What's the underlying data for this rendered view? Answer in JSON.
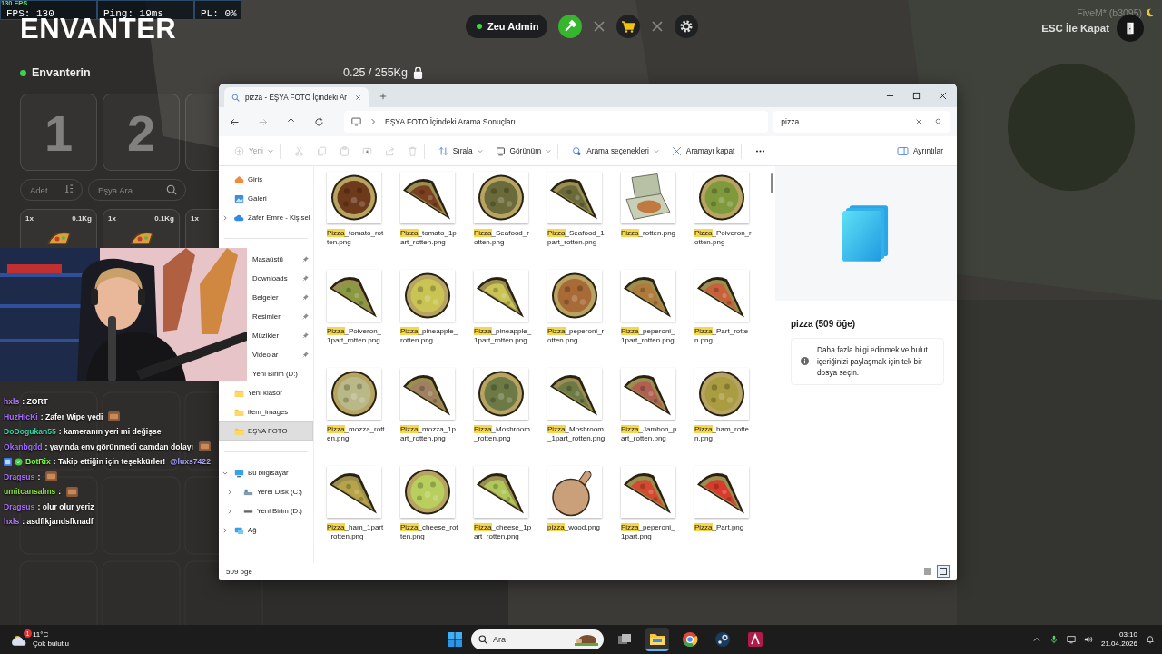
{
  "perf": {
    "fps_small": "130 FPS",
    "fps": "FPS: 130",
    "ping": "Ping: 19ms",
    "pl": "PL: 0%"
  },
  "hud": {
    "title": "ENVANTER",
    "inventory_label": "Envanterin",
    "weight": "0.25 / 255Kg",
    "amount_placeholder": "Adet",
    "search_placeholder": "Eşya Ara",
    "slots": [
      {
        "kind": "number",
        "number": "1"
      },
      {
        "kind": "number",
        "number": "2"
      },
      {
        "kind": "empty"
      }
    ],
    "item_slots": [
      {
        "count": "1x",
        "weight": "0.1Kg"
      },
      {
        "count": "1x",
        "weight": "0.1Kg"
      },
      {
        "count": "1x"
      }
    ]
  },
  "admin": {
    "name": "Zeu Admin",
    "tools": [
      {
        "kind": "tool",
        "active": true
      },
      {
        "kind": "close",
        "active": false
      },
      {
        "kind": "cart",
        "active": false
      },
      {
        "kind": "close",
        "active": false
      },
      {
        "kind": "settings",
        "active": false
      }
    ]
  },
  "top_right": {
    "build": "FiveM* (b3095)",
    "close_hint": "ESC İle Kapat"
  },
  "chat": [
    {
      "user": "hxls",
      "color": "#b07cff",
      "text": ": ZORT"
    },
    {
      "user": "HuzHicKi",
      "color": "#a56cff",
      "text": ": Zafer Wipe yedi",
      "emote": true
    },
    {
      "user": "DoDogukan55",
      "color": "#2fd6a6",
      "text": ": kameranın yeri mi değişse"
    },
    {
      "user": "Okanbgdd",
      "color": "#9d6cff",
      "text": ": yayında env görünmedi camdan dolayı",
      "emote": true
    },
    {
      "user": "BotRix",
      "color": "#7dff3a",
      "text": ": Takip ettiğin için teşekkürler!",
      "mention": "@luxs7422",
      "badges": true
    },
    {
      "user": "Dragsus",
      "color": "#a56cff",
      "text": ":",
      "emote": true
    },
    {
      "user": "umitcansalms",
      "color": "#8fe03c",
      "text": ":",
      "emote": true
    },
    {
      "user": "Dragsus",
      "color": "#a56cff",
      "text": ": olur olur yeriz"
    },
    {
      "user": "hxls",
      "color": "#b07cff",
      "text": ": asdflkjandsfknadf"
    }
  ],
  "explorer": {
    "tab_title": "pizza - EŞYA FOTO İçindeki Ar",
    "address": "EŞYA FOTO İçindeki Arama Sonuçları",
    "search": "pizza",
    "history": [
      {
        "kind": "back",
        "disabled": false
      },
      {
        "kind": "forward",
        "disabled": true
      },
      {
        "kind": "up",
        "disabled": false
      },
      {
        "kind": "refresh",
        "disabled": false
      }
    ],
    "toolbar": [
      {
        "kind": "new",
        "label": "Yeni",
        "disabled": true,
        "dropdown": true
      },
      {
        "kind": "cut",
        "disabled": true
      },
      {
        "kind": "copy",
        "disabled": true
      },
      {
        "kind": "paste",
        "disabled": true
      },
      {
        "kind": "rename",
        "disabled": true
      },
      {
        "kind": "share",
        "disabled": true
      },
      {
        "kind": "delete",
        "disabled": true
      },
      {
        "kind": "sort",
        "label": "Sırala",
        "disabled": false,
        "dropdown": true
      },
      {
        "kind": "view",
        "label": "Görünüm",
        "disabled": false,
        "dropdown": true
      },
      {
        "kind": "search-options",
        "label": "Arama seçenekleri",
        "disabled": false,
        "dropdown": true
      },
      {
        "kind": "close-search",
        "label": "Aramayı kapat",
        "disabled": false
      },
      {
        "kind": "more",
        "disabled": false
      }
    ],
    "details_toggle": "Ayrıntılar",
    "nav": [
      {
        "items": [
          {
            "label": "Giriş",
            "kind": "home",
            "selected": false
          },
          {
            "label": "Galeri",
            "kind": "gallery",
            "selected": false
          },
          {
            "label": "Zafer Emre - Kişisel",
            "kind": "cloud",
            "expanded": false,
            "selected": false
          }
        ]
      },
      {
        "items": [
          {
            "label": "Masaüstü",
            "pinned": true,
            "selected": false
          },
          {
            "label": "Downloads",
            "pinned": true,
            "selected": false
          },
          {
            "label": "Belgeler",
            "pinned": true,
            "selected": false
          },
          {
            "label": "Resimler",
            "pinned": true,
            "selected": false
          },
          {
            "label": "Müzikler",
            "pinned": true,
            "selected": false
          },
          {
            "label": "Videolar",
            "pinned": true,
            "selected": false
          },
          {
            "label": "Yeni Birim (D:)",
            "selected": false
          },
          {
            "label": "Yeni klasör",
            "kind": "folder",
            "selected": false
          },
          {
            "label": "item_images",
            "kind": "folder",
            "selected": false
          },
          {
            "label": "EŞYA FOTO",
            "kind": "folder",
            "selected": true
          }
        ]
      },
      {
        "items": [
          {
            "label": "Bu bilgisayar",
            "kind": "pc",
            "expanded": true,
            "selected": false,
            "children": [
              {
                "label": "Yerel Disk (C:)",
                "kind": "disk",
                "expanded": false,
                "selected": false
              },
              {
                "label": "Yeni Birim (D:)",
                "kind": "drive",
                "expanded": false,
                "selected": false
              }
            ]
          },
          {
            "label": "Ağ",
            "kind": "network",
            "expanded": false,
            "selected": false
          }
        ]
      }
    ],
    "files": [
      {
        "match": "Pizza",
        "rest": "_tomato_rotten.png",
        "kind": "whole",
        "selected": false
      },
      {
        "match": "Pizza",
        "rest": "_tomato_1part_rotten.png",
        "kind": "slice",
        "selected": false
      },
      {
        "match": "Pizza",
        "rest": "_Seafood_rotten.png",
        "kind": "whole",
        "selected": false
      },
      {
        "match": "Pizza",
        "rest": "_Seafood_1part_rotten.png",
        "kind": "slice",
        "selected": false
      },
      {
        "match": "Pizza",
        "rest": "_rotten.png",
        "kind": "box",
        "selected": false
      },
      {
        "match": "Pizza",
        "rest": "_Poiveron_rotten.png",
        "kind": "whole",
        "selected": false
      },
      {
        "match": "Pizza",
        "rest": "_Poiveron_1part_rotten.png",
        "kind": "slice",
        "selected": false
      },
      {
        "match": "Pizza",
        "rest": "_pineapple_rotten.png",
        "kind": "whole",
        "selected": false
      },
      {
        "match": "Pizza",
        "rest": "_pineapple_1part_rotten.png",
        "kind": "slice",
        "selected": false
      },
      {
        "match": "Pizza",
        "rest": "_peperoni_rotten.png",
        "kind": "whole",
        "selected": false
      },
      {
        "match": "Pizza",
        "rest": "_peperoni_1part_rotten.png",
        "kind": "slice",
        "selected": false
      },
      {
        "match": "Pizza",
        "rest": "_Part_rotten.png",
        "kind": "slice",
        "selected": false
      },
      {
        "match": "Pizza",
        "rest": "_mozza_rotten.png",
        "kind": "whole",
        "selected": false
      },
      {
        "match": "Pizza",
        "rest": "_mozza_1part_rotten.png",
        "kind": "slice",
        "selected": false
      },
      {
        "match": "Pizza",
        "rest": "_Moshroom_rotten.png",
        "kind": "whole",
        "selected": false
      },
      {
        "match": "Pizza",
        "rest": "_Moshroom_1part_rotten.png",
        "kind": "slice",
        "selected": false
      },
      {
        "match": "Pizza",
        "rest": "_Jambon_part_rotten.png",
        "kind": "slice",
        "selected": false
      },
      {
        "match": "Pizza",
        "rest": "_ham_rotten.png",
        "kind": "whole",
        "selected": false
      },
      {
        "match": "Pizza",
        "rest": "_ham_1part_rotten.png",
        "kind": "slice",
        "selected": false
      },
      {
        "match": "Pizza",
        "rest": "_cheese_rotten.png",
        "kind": "whole",
        "selected": false
      },
      {
        "match": "Pizza",
        "rest": "_cheese_1part_rotten.png",
        "kind": "slice",
        "selected": false
      },
      {
        "match": "pizza",
        "rest": "_wood.png",
        "kind": "board",
        "selected": false
      },
      {
        "match": "Pizza",
        "rest": "_peperoni_1part.png",
        "kind": "slice",
        "selected": false
      },
      {
        "match": "Pizza",
        "rest": "_Part.png",
        "kind": "slice",
        "selected": false
      }
    ],
    "details": {
      "title": "pizza (509 öğe)",
      "info": "Daha fazla bilgi edinmek ve bulut içeriğinizi paylaşmak için tek bir dosya seçin."
    },
    "status": "509 öğe",
    "views": [
      {
        "kind": "details",
        "selected": false
      },
      {
        "kind": "tiles",
        "selected": true
      }
    ]
  },
  "taskbar": {
    "weather": {
      "temp": "11°C",
      "desc": "Çok bulutlu",
      "badge": "1"
    },
    "search_placeholder": "Ara",
    "apps": [
      {
        "kind": "task-view",
        "active": false
      },
      {
        "kind": "explorer",
        "active": true
      },
      {
        "kind": "chrome",
        "active": false
      },
      {
        "kind": "steam",
        "active": false
      },
      {
        "kind": "app",
        "active": false
      }
    ],
    "time": "03:10",
    "date": "21.04.2026"
  }
}
